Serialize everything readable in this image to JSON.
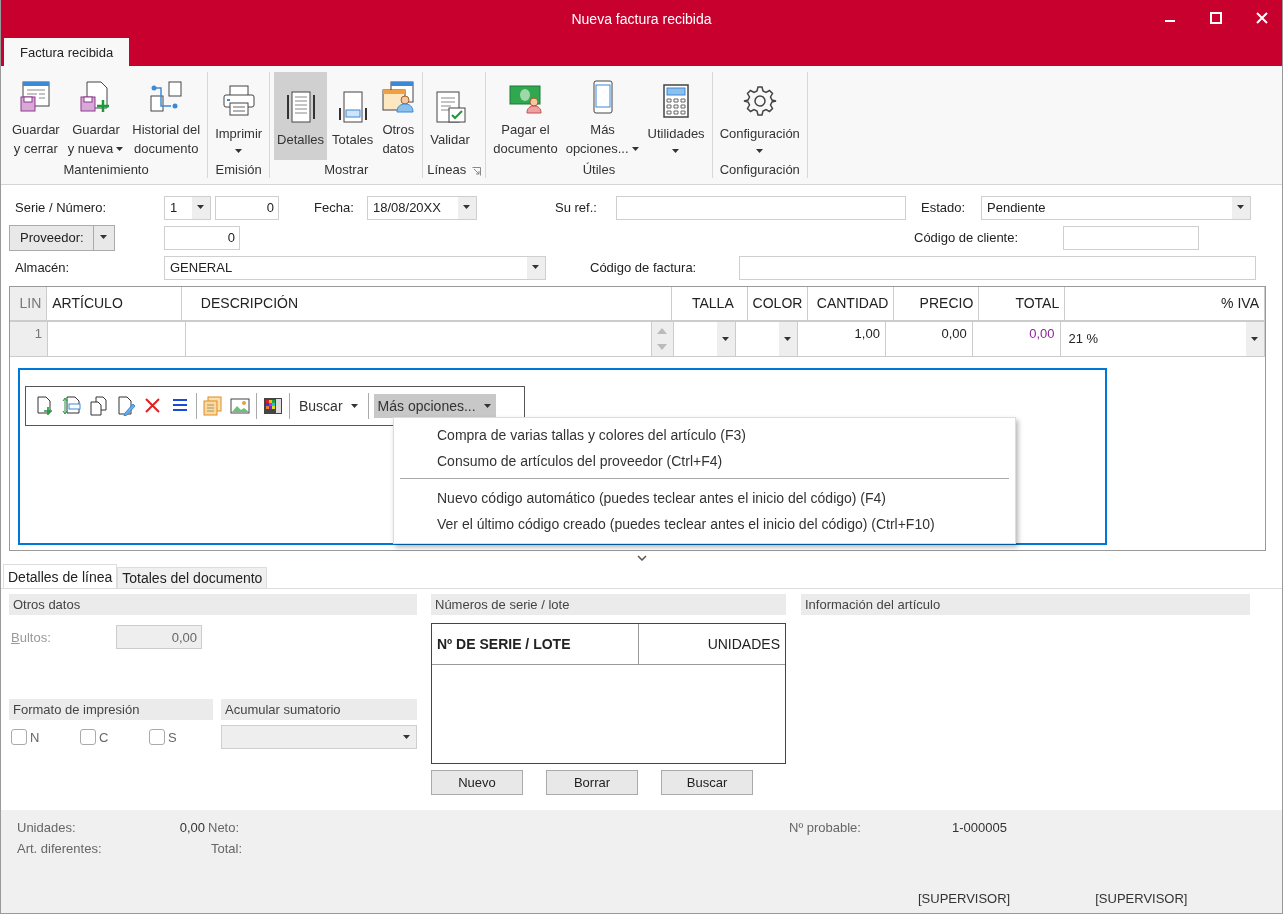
{
  "window": {
    "title": "Nueva factura recibida"
  },
  "ribbon_tabs": [
    {
      "label": "Factura recibida",
      "selected": true
    }
  ],
  "ribbon_groups": [
    {
      "label": "Mantenimiento",
      "buttons": [
        {
          "label": "Guardar\ny cerrar",
          "dropdown": false,
          "selected": false
        },
        {
          "label": "Guardar\ny nueva",
          "dropdown": true,
          "selected": false
        },
        {
          "label": "Historial del\ndocumento",
          "dropdown": false,
          "selected": false
        }
      ]
    },
    {
      "label": "Emisión",
      "buttons": [
        {
          "label": "Imprimir",
          "dropdown": true,
          "selected": false
        }
      ]
    },
    {
      "label": "Mostrar",
      "buttons": [
        {
          "label": "Detalles",
          "dropdown": false,
          "selected": true
        },
        {
          "label": "Totales",
          "dropdown": false,
          "selected": false
        },
        {
          "label": "Otros\ndatos",
          "dropdown": false,
          "selected": false
        }
      ]
    },
    {
      "label": "Líneas",
      "launcher": true,
      "buttons": [
        {
          "label": "Validar",
          "dropdown": false,
          "selected": false
        }
      ]
    },
    {
      "label": "Útiles",
      "buttons": [
        {
          "label": "Pagar el\ndocumento",
          "dropdown": false,
          "selected": false
        },
        {
          "label": "Más\nopciones...",
          "dropdown": true,
          "selected": false
        },
        {
          "label": "Utilidades",
          "dropdown": true,
          "selected": false
        }
      ]
    },
    {
      "label": "Configuración",
      "buttons": [
        {
          "label": "Configuración",
          "dropdown": true,
          "selected": false
        }
      ]
    }
  ],
  "header": {
    "serie": {
      "label": "Serie / Número:",
      "value": "1"
    },
    "numero": {
      "value": "0"
    },
    "fecha": {
      "label": "Fecha:",
      "value": "18/08/20XX"
    },
    "su_ref": {
      "label": "Su ref.:"
    },
    "estado": {
      "label": "Estado:",
      "value": "Pendiente"
    },
    "proveedor": {
      "label": "Proveedor:",
      "value": "0"
    },
    "codigo_cliente": {
      "label": "Código de cliente:"
    },
    "almacen": {
      "label": "Almacén:",
      "value": "GENERAL"
    },
    "codigo_factura": {
      "label": "Código de factura:"
    }
  },
  "lines_table": {
    "columns": [
      {
        "label": "LIN",
        "kind": "index"
      },
      {
        "label": "ARTÍCULO",
        "kind": "text"
      },
      {
        "label": "DESCRIPCIÓN",
        "kind": "memo"
      },
      {
        "label": "TALLA",
        "kind": "combo"
      },
      {
        "label": "COLOR",
        "kind": "combo"
      },
      {
        "label": "CANTIDAD",
        "kind": "number"
      },
      {
        "label": "PRECIO",
        "kind": "number"
      },
      {
        "label": "TOTAL",
        "kind": "total"
      },
      {
        "label": "% IVA",
        "kind": "combo"
      }
    ],
    "rows": [
      {
        "lin": "1",
        "cantidad": "1,00",
        "precio": "0,00",
        "total": "0,00",
        "iva": "21 %"
      }
    ]
  },
  "line_toolbar": {
    "search_button": {
      "label": "Buscar"
    },
    "more_button": {
      "label": "Más opciones...",
      "expanded": true
    },
    "menu": [
      {
        "label": "Compra de varias tallas y colores del artículo (F3)"
      },
      {
        "label": "Consumo de artículos del proveedor (Ctrl+F4)"
      },
      {
        "label": "Nuevo código automático (puedes teclear antes el inicio del código) (F4)",
        "separator_before": true
      },
      {
        "label": "Ver el último código creado (puedes teclear antes el inicio del código) (Ctrl+F10)"
      }
    ]
  },
  "bottom_tabs": [
    {
      "label": "Detalles de línea",
      "selected": true
    },
    {
      "label": "Totales del documento",
      "selected": false
    }
  ],
  "otros_datos": {
    "title": "Otros datos",
    "bultos": {
      "label": "Bultos:",
      "value": "0,00",
      "disabled": true
    }
  },
  "formato_impresion": {
    "title": "Formato de impresión",
    "options": [
      {
        "label": "N",
        "checked": false
      },
      {
        "label": "C",
        "checked": false
      },
      {
        "label": "S",
        "checked": false
      }
    ]
  },
  "acumular_sumatorio": {
    "title": "Acumular sumatorio",
    "disabled": true
  },
  "numeros_serie": {
    "title": "Números de serie / lote",
    "columns": [
      "Nº DE SERIE / LOTE",
      "UNIDADES"
    ],
    "buttons": [
      "Nuevo",
      "Borrar",
      "Buscar"
    ]
  },
  "informacion_articulo": {
    "title": "Información del artículo"
  },
  "status_bar": {
    "unidades": {
      "label": "Unidades:",
      "value": "0,00"
    },
    "art_diferentes": {
      "label": "Art. diferentes:"
    },
    "neto": {
      "label": "Neto:"
    },
    "total": {
      "label": "Total:"
    },
    "n_probable": {
      "label": "Nº probable:",
      "value": "1-000005"
    },
    "users": [
      "[SUPERVISOR]",
      "[SUPERVISOR]"
    ]
  }
}
